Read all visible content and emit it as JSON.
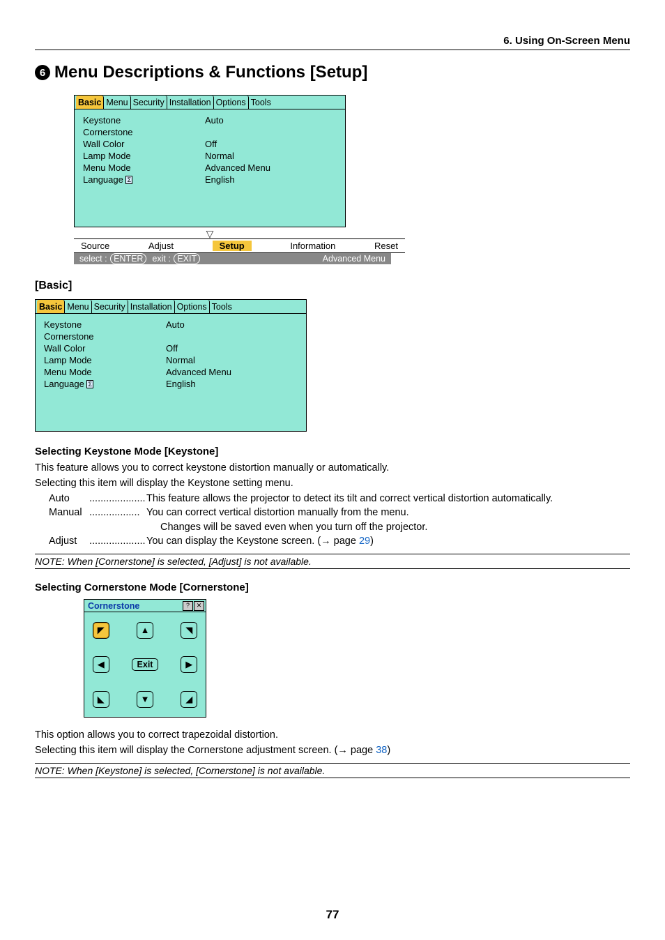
{
  "chapter": "6. Using On-Screen Menu",
  "section_number": "6",
  "section_title": "Menu Descriptions & Functions [Setup]",
  "osd": {
    "tabs": [
      "Basic",
      "Menu",
      "Security",
      "Installation",
      "Options",
      "Tools"
    ],
    "active_tab": "Basic",
    "rows": [
      {
        "label": "Keystone",
        "value": "Auto"
      },
      {
        "label": "Cornerstone",
        "value": ""
      },
      {
        "label": "Wall Color",
        "value": "Off"
      },
      {
        "label": "Lamp Mode",
        "value": "Normal"
      },
      {
        "label": "Menu Mode",
        "value": "Advanced Menu"
      },
      {
        "label": "Language",
        "value": "English",
        "icon": true
      }
    ],
    "nav": [
      "Source",
      "Adjust",
      "Setup",
      "Information",
      "Reset"
    ],
    "nav_active": "Setup",
    "footer_select": "select :",
    "footer_select_btn": "ENTER",
    "footer_exit": "exit :",
    "footer_exit_btn": "EXIT",
    "footer_right": "Advanced Menu"
  },
  "basic_heading": "[Basic]",
  "keystone": {
    "heading": "Selecting Keystone Mode [Keystone]",
    "p1": "This feature allows you to correct keystone distortion manually or automatically.",
    "p2": "Selecting this item will display the Keystone setting menu.",
    "defs": [
      {
        "term": "Auto",
        "desc": "This feature allows the projector to detect its tilt and correct vertical distortion automatically."
      },
      {
        "term": "Manual",
        "desc": "You can correct vertical distortion manually from the menu."
      },
      {
        "term": "",
        "desc": "Changes will be saved even when you turn off the projector."
      },
      {
        "term": "Adjust",
        "desc": "You can display the Keystone screen. (→ page ",
        "link": "29",
        "desc_after": ")"
      }
    ],
    "note": "NOTE: When [Cornerstone] is selected, [Adjust] is not available."
  },
  "cornerstone": {
    "heading": "Selecting Cornerstone Mode [Cornerstone]",
    "panel_title": "Cornerstone",
    "exit_label": "Exit",
    "buttons": {
      "tl": "◤",
      "tc": "▲",
      "tr": "◥",
      "ml": "◀",
      "mr": "▶",
      "bl": "◣",
      "bc": "▼",
      "br": "◢"
    },
    "p1": "This option allows you to correct trapezoidal distortion.",
    "p2a": "Selecting this item will display the Cornerstone adjustment screen. (→ page ",
    "p2_link": "38",
    "p2b": ")",
    "note": "NOTE: When [Keystone] is selected, [Cornerstone] is not available."
  },
  "page_number": "77"
}
